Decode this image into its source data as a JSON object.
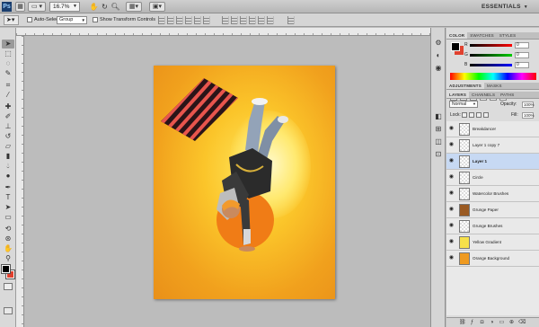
{
  "appbar": {
    "logo": "Ps",
    "zoom": "16.7%",
    "workspace": "ESSENTIALS"
  },
  "options": {
    "auto_select_label": "Auto-Select:",
    "auto_select_value": "Group",
    "show_transform_label": "Show Transform Controls"
  },
  "panels": {
    "color_tabs": [
      "COLOR",
      "SWATCHES",
      "STYLES"
    ],
    "color": {
      "r": "0",
      "g": "0",
      "b": "0",
      "r_label": "R",
      "g_label": "G",
      "b_label": "B",
      "fg": "#000000",
      "bg": "#e0412f"
    },
    "adjust_tabs": [
      "ADJUSTMENTS",
      "MASKS"
    ],
    "layers_tabs": [
      "LAYERS",
      "CHANNELS",
      "PATHS"
    ],
    "blend_mode": "Normal",
    "opacity_label": "Opacity:",
    "opacity": "100%",
    "lock_label": "Lock:",
    "fill_label": "Fill:",
    "fill": "100%"
  },
  "layers": [
    {
      "name": "Breakdancer",
      "thumb": "checker",
      "visible": true,
      "selected": false
    },
    {
      "name": "Layer 1 copy 7",
      "thumb": "checker",
      "visible": true,
      "selected": false
    },
    {
      "name": "Layer 1",
      "thumb": "checker",
      "visible": true,
      "selected": true
    },
    {
      "name": "Circle",
      "thumb": "checker",
      "visible": true,
      "selected": false
    },
    {
      "name": "Watercolor Brushes",
      "thumb": "checker",
      "visible": true,
      "selected": false
    },
    {
      "name": "Grunge Paper",
      "thumb": "#9a5a22",
      "visible": true,
      "selected": false
    },
    {
      "name": "Grunge Brushes",
      "thumb": "checker",
      "visible": true,
      "selected": false
    },
    {
      "name": "Yellow Gradient",
      "thumb": "#f6e04a",
      "visible": true,
      "selected": false
    },
    {
      "name": "Orange Background",
      "thumb": "#ef9a20",
      "visible": true,
      "selected": false
    }
  ],
  "colors": {
    "artwork_orange": "#f1a11d",
    "artwork_yellow": "#ffe45a",
    "stripe_red": "#e8554d",
    "stripe_black": "#2a1418",
    "circle": "#f07c16"
  }
}
